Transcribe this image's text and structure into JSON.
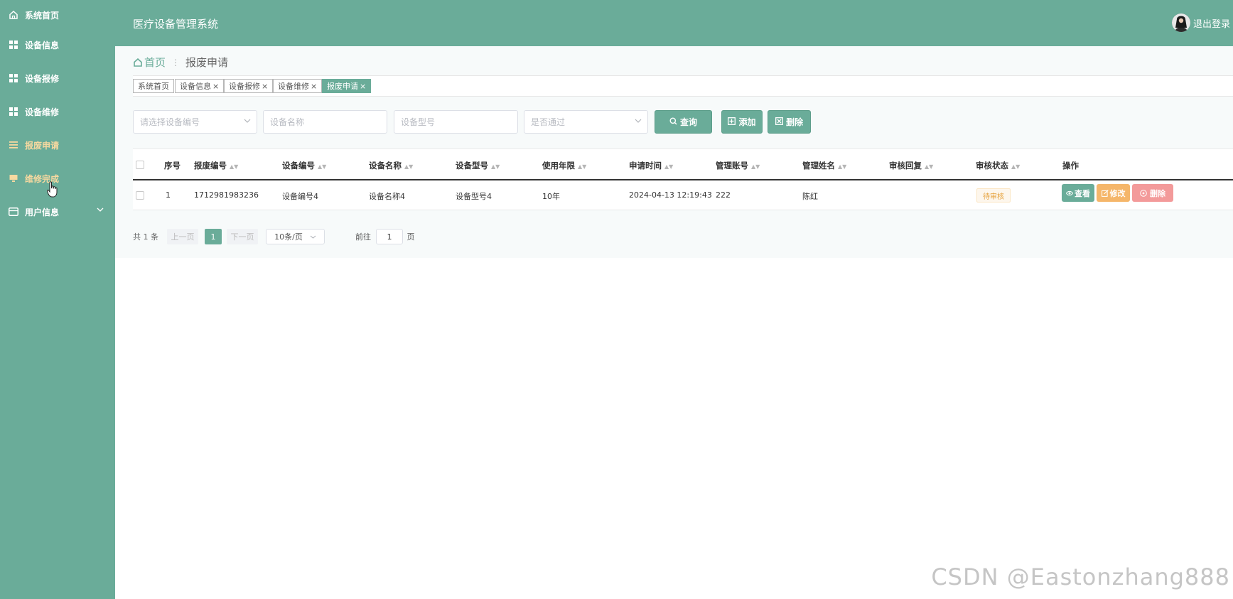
{
  "app": {
    "title": "医疗设备管理系统",
    "logout": "退出登录"
  },
  "sidebar": {
    "items": [
      {
        "label": "系统首页",
        "icon": "home-icon"
      },
      {
        "label": "设备信息",
        "icon": "grid-icon"
      },
      {
        "label": "设备报修",
        "icon": "grid-icon"
      },
      {
        "label": "设备维修",
        "icon": "grid-icon"
      },
      {
        "label": "报废申请",
        "icon": "list-icon"
      },
      {
        "label": "维修完成",
        "icon": "monitor-icon"
      },
      {
        "label": "用户信息",
        "icon": "card-icon"
      }
    ]
  },
  "breadcrumb": {
    "home": "首页",
    "current": "报废申请"
  },
  "tags": [
    {
      "label": "系统首页"
    },
    {
      "label": "设备信息"
    },
    {
      "label": "设备报修"
    },
    {
      "label": "设备维修"
    },
    {
      "label": "报废申请"
    }
  ],
  "search": {
    "device_no_placeholder": "请选择设备编号",
    "device_name_placeholder": "设备名称",
    "device_model_placeholder": "设备型号",
    "passed_placeholder": "是否通过",
    "query_label": "查询",
    "add_label": "添加",
    "delete_label": "删除"
  },
  "table": {
    "headers": [
      "序号",
      "报废编号",
      "设备编号",
      "设备名称",
      "设备型号",
      "使用年限",
      "申请时间",
      "管理账号",
      "管理姓名",
      "审核回复",
      "审核状态",
      "操作"
    ],
    "rows": [
      {
        "index": "1",
        "scrap_no": "1712981983236",
        "device_no": "设备编号4",
        "device_name": "设备名称4",
        "device_model": "设备型号4",
        "years": "10年",
        "apply_time": "2024-04-13 12:19:43",
        "account": "222",
        "manager": "陈红",
        "reply": "",
        "status": "待审核"
      }
    ],
    "actions": {
      "view": "查看",
      "edit": "修改",
      "delete": "删除"
    }
  },
  "pagination": {
    "total": "共 1 条",
    "prev": "上一页",
    "page": "1",
    "next": "下一页",
    "page_size": "10条/页",
    "goto": "前往",
    "goto_value": "1",
    "page_unit": "页"
  },
  "watermark": "CSDN @Eastonzhang888",
  "colors": {
    "primary": "#6aac99",
    "warning": "#f5b66a",
    "danger": "#f39a9a",
    "active_menu": "#f7d9a0"
  }
}
